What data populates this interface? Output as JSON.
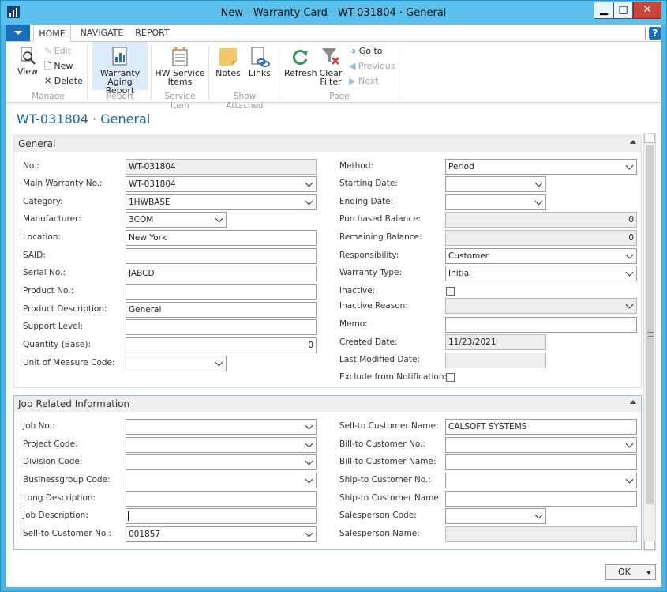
{
  "window": {
    "title": "New - Warranty Card - WT-031804 · General",
    "minimize": "▁",
    "maximize": "□",
    "close": "✕"
  },
  "ribbon_tabs": [
    "HOME",
    "NAVIGATE",
    "REPORT"
  ],
  "ribbon": {
    "view": "View",
    "edit": "Edit",
    "new": "New",
    "delete": "Delete",
    "warranty_aging_report_1": "Warranty",
    "warranty_aging_report_2": "Aging Report",
    "hw_service_items_1": "HW Service",
    "hw_service_items_2": "Items",
    "notes": "Notes",
    "links": "Links",
    "refresh": "Refresh",
    "clear_filter_1": "Clear",
    "clear_filter_2": "Filter",
    "go_to": "Go to",
    "previous": "Previous",
    "next": "Next",
    "groups": {
      "manage": "Manage",
      "report": "Report",
      "service_item": "Service Item",
      "show_attached": "Show Attached",
      "page": "Page"
    }
  },
  "page_title": "WT-031804 · General",
  "general": {
    "header": "General",
    "left": [
      {
        "label": "No.:",
        "value": "WT-031804"
      },
      {
        "label": "Main Warranty No.:",
        "value": "WT-031804"
      },
      {
        "label": "Category:",
        "value": "1HWBASE"
      },
      {
        "label": "Manufacturer:",
        "value": "3COM"
      },
      {
        "label": "Location:",
        "value": "New York"
      },
      {
        "label": "SAID:",
        "value": ""
      },
      {
        "label": "Serial No.:",
        "value": "JABCD"
      },
      {
        "label": "Product No.:",
        "value": ""
      },
      {
        "label": "Product Description:",
        "value": "General"
      },
      {
        "label": "Support Level:",
        "value": ""
      },
      {
        "label": "Quantity (Base):",
        "value": "0"
      },
      {
        "label": "Unit of Measure Code:",
        "value": ""
      }
    ],
    "right": [
      {
        "label": "Method:",
        "value": "Period"
      },
      {
        "label": "Starting Date:",
        "value": ""
      },
      {
        "label": "Ending Date:",
        "value": ""
      },
      {
        "label": "Purchased Balance:",
        "value": "0"
      },
      {
        "label": "Remaining Balance:",
        "value": "0"
      },
      {
        "label": "Responsibility:",
        "value": "Customer"
      },
      {
        "label": "Warranty Type:",
        "value": "Initial"
      },
      {
        "label": "Inactive:",
        "value": ""
      },
      {
        "label": "Inactive Reason:",
        "value": ""
      },
      {
        "label": "Memo:",
        "value": ""
      },
      {
        "label": "Created Date:",
        "value": "11/23/2021"
      },
      {
        "label": "Last Modified Date:",
        "value": ""
      },
      {
        "label": "Exclude from Notification:",
        "value": ""
      }
    ]
  },
  "job": {
    "header": "Job Related Information",
    "left": [
      {
        "label": "Job No.:",
        "value": ""
      },
      {
        "label": "Project Code:",
        "value": ""
      },
      {
        "label": "Division Code:",
        "value": ""
      },
      {
        "label": "Businessgroup Code:",
        "value": ""
      },
      {
        "label": "Long Description:",
        "value": ""
      },
      {
        "label": "Job Description:",
        "value": ""
      },
      {
        "label": "Sell-to Customer No.:",
        "value": "001857"
      }
    ],
    "right": [
      {
        "label": "Sell-to Customer Name:",
        "value": "CALSOFT SYSTEMS"
      },
      {
        "label": "Bill-to Customer No.:",
        "value": ""
      },
      {
        "label": "Bill-to Customer Name:",
        "value": ""
      },
      {
        "label": "Ship-to Customer No.:",
        "value": ""
      },
      {
        "label": "Ship-to Customer Name:",
        "value": ""
      },
      {
        "label": "Salesperson Code:",
        "value": ""
      },
      {
        "label": "Salesperson Name:",
        "value": ""
      }
    ]
  },
  "ok_button": "OK"
}
